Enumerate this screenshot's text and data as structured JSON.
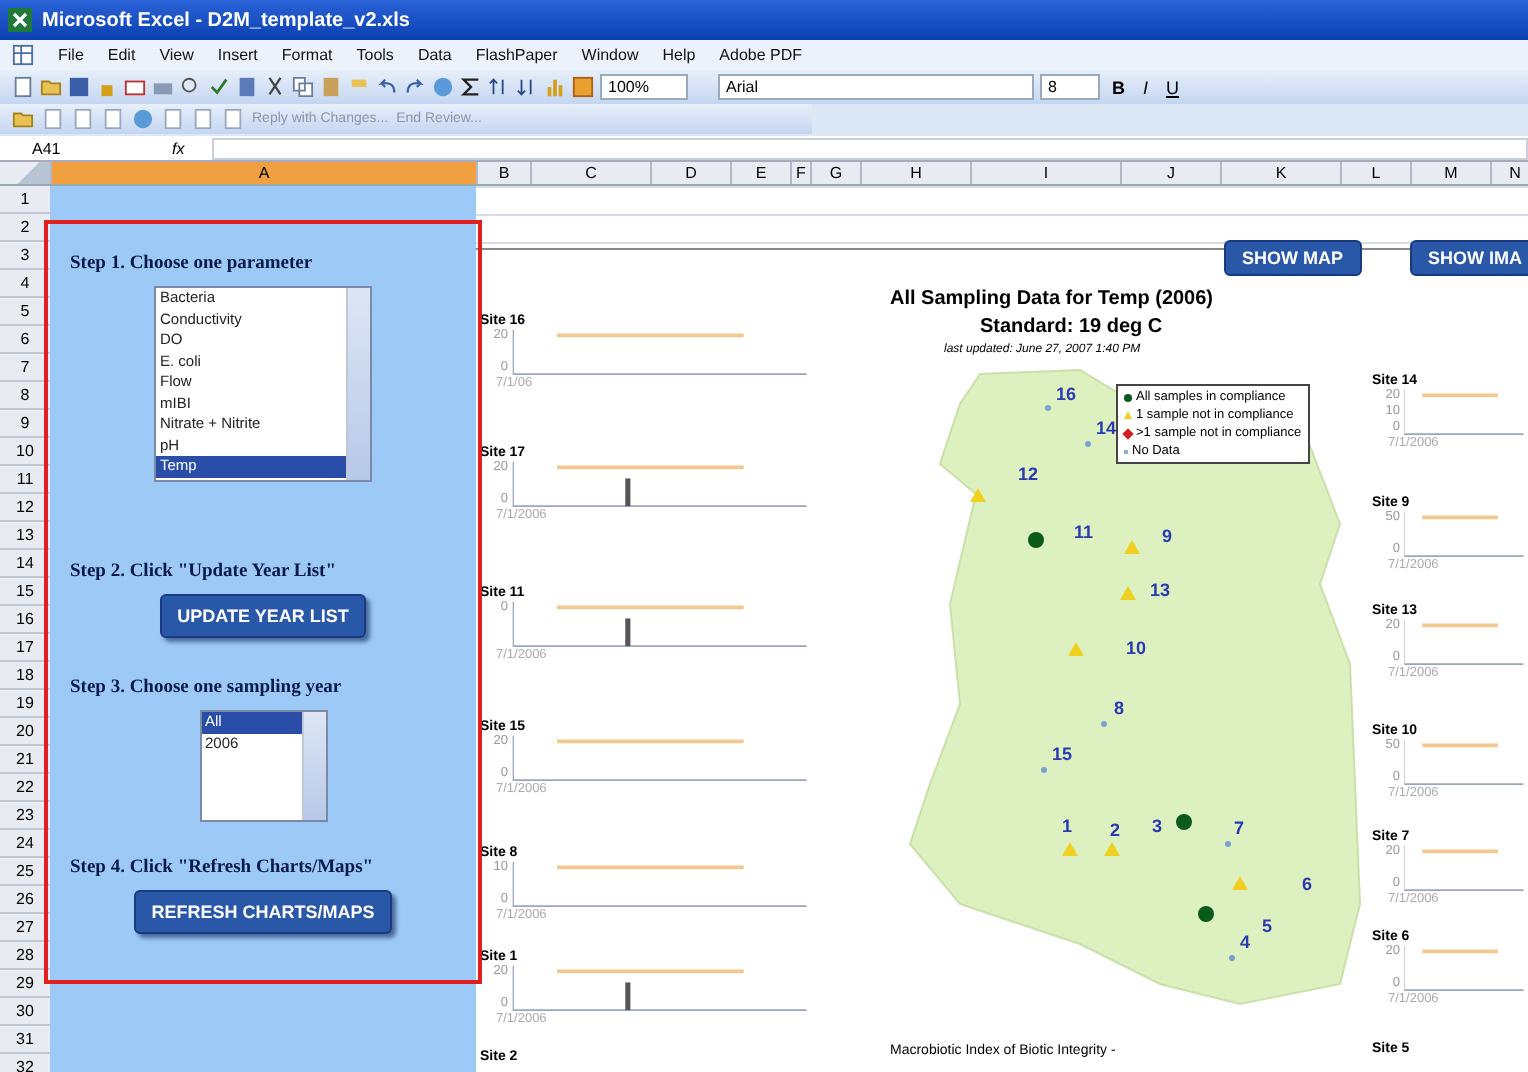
{
  "window": {
    "title": "Microsoft Excel - D2M_template_v2.xls"
  },
  "menu": [
    "File",
    "Edit",
    "View",
    "Insert",
    "Format",
    "Tools",
    "Data",
    "FlashPaper",
    "Window",
    "Help",
    "Adobe PDF"
  ],
  "toolbar": {
    "zoom": "100%",
    "font": "Arial",
    "size": "8",
    "format_buttons": [
      "B",
      "I",
      "U"
    ]
  },
  "review_toolbar": {
    "reply": "Reply with Changes...",
    "end": "End Review..."
  },
  "formula_bar": {
    "name_box": "A41",
    "fx": "fx"
  },
  "columns": [
    "A",
    "B",
    "C",
    "D",
    "E",
    "F",
    "G",
    "H",
    "I",
    "J",
    "K",
    "L",
    "M",
    "N"
  ],
  "row_numbers": [
    "1",
    "2",
    "3",
    "4",
    "5",
    "6",
    "7",
    "8",
    "9",
    "10",
    "11",
    "12",
    "13",
    "14",
    "15",
    "16",
    "17",
    "18",
    "19",
    "20",
    "21",
    "22",
    "23",
    "24",
    "25",
    "26",
    "27",
    "28",
    "29",
    "30",
    "31",
    "32"
  ],
  "panel": {
    "steps": [
      {
        "kind": "text",
        "text": "Step 1. Choose one parameter"
      },
      {
        "kind": "list",
        "items": [
          {
            "label": "Bacteria",
            "selected": false
          },
          {
            "label": "Conductivity",
            "selected": false
          },
          {
            "label": "DO",
            "selected": false
          },
          {
            "label": "E. coli",
            "selected": false
          },
          {
            "label": "Flow",
            "selected": false
          },
          {
            "label": "mIBI",
            "selected": false
          },
          {
            "label": "Nitrate + Nitrite",
            "selected": false
          },
          {
            "label": "pH",
            "selected": false
          },
          {
            "label": "Temp",
            "selected": true
          }
        ]
      },
      {
        "kind": "text",
        "text": "Step 2. Click \"Update Year List\""
      },
      {
        "kind": "button",
        "text": "UPDATE YEAR LIST"
      },
      {
        "kind": "text",
        "text": "Step 3. Choose one sampling year"
      },
      {
        "kind": "list",
        "items": [
          {
            "label": "All",
            "selected": true
          },
          {
            "label": "2006",
            "selected": false
          }
        ]
      },
      {
        "kind": "text",
        "text": "Step 4. Click \"Refresh Charts/Maps\""
      },
      {
        "kind": "button",
        "text": "REFRESH CHARTS/MAPS"
      }
    ]
  },
  "sheet_buttons": [
    "SHOW MAP",
    "SHOW IMA"
  ],
  "map": {
    "title": "All Sampling Data for Temp (2006)",
    "standard": "Standard: 19 deg C",
    "updated": "last updated: June 27, 2007 1:40 PM",
    "legend": [
      {
        "kind": "pass",
        "text": "All samples in compliance"
      },
      {
        "kind": "one",
        "text": "1 sample not in compliance"
      },
      {
        "kind": "many",
        "text": ">1 sample not in compliance"
      },
      {
        "kind": "none",
        "text": "No Data"
      }
    ],
    "sites": [
      {
        "label": "16",
        "kind": "none"
      },
      {
        "label": "14",
        "kind": "none"
      },
      {
        "label": "12",
        "kind": "one"
      },
      {
        "label": "11",
        "kind": "pass"
      },
      {
        "label": "9",
        "kind": "one"
      },
      {
        "label": "13",
        "kind": "one"
      },
      {
        "label": "10",
        "kind": "one"
      },
      {
        "label": "8",
        "kind": "none"
      },
      {
        "label": "15",
        "kind": "none"
      },
      {
        "label": "1",
        "kind": "one"
      },
      {
        "label": "2",
        "kind": "one"
      },
      {
        "label": "3",
        "kind": "pass"
      },
      {
        "label": "7",
        "kind": "none"
      },
      {
        "label": "6",
        "kind": "one"
      },
      {
        "label": "5",
        "kind": "pass"
      },
      {
        "label": "4",
        "kind": "none"
      }
    ],
    "footer": "Macrobiotic Index of Biotic Integrity -"
  },
  "site_charts": [
    {
      "title": "Site 16",
      "ticks": [
        "20",
        "0"
      ],
      "date": "7/1/06",
      "sample_bar": false
    },
    {
      "title": "Site 17",
      "ticks": [
        "20",
        "0"
      ],
      "date": "7/1/2006",
      "sample_bar": true
    },
    {
      "title": "Site 11",
      "ticks": [
        "0"
      ],
      "date": "7/1/2006",
      "sample_bar": true
    },
    {
      "title": "Site 15",
      "ticks": [
        "20",
        "0"
      ],
      "date": "7/1/2006",
      "sample_bar": false
    },
    {
      "title": "Site 8",
      "ticks": [
        "10",
        "0"
      ],
      "date": "7/1/2006",
      "sample_bar": false
    },
    {
      "title": "Site 1",
      "ticks": [
        "20",
        "0"
      ],
      "date": "7/1/2006",
      "sample_bar": true
    },
    {
      "title": "Site 2"
    },
    {
      "title": "Site 14",
      "ticks": [
        "20",
        "10",
        "0"
      ],
      "date": "7/1/2006",
      "sample_bar": false
    },
    {
      "title": "Site 9",
      "ticks": [
        "50",
        "0"
      ],
      "date": "7/1/2006",
      "sample_bar": false
    },
    {
      "title": "Site 13",
      "ticks": [
        "20",
        "0"
      ],
      "date": "7/1/2006",
      "sample_bar": false
    },
    {
      "title": "Site 10",
      "ticks": [
        "50",
        "0"
      ],
      "date": "7/1/2006",
      "sample_bar": false
    },
    {
      "title": "Site 7",
      "ticks": [
        "20",
        "0"
      ],
      "date": "7/1/2006",
      "sample_bar": false
    },
    {
      "title": "Site 6",
      "ticks": [
        "20",
        "0"
      ],
      "date": "7/1/2006",
      "sample_bar": false
    },
    {
      "title": "Site 5"
    }
  ]
}
